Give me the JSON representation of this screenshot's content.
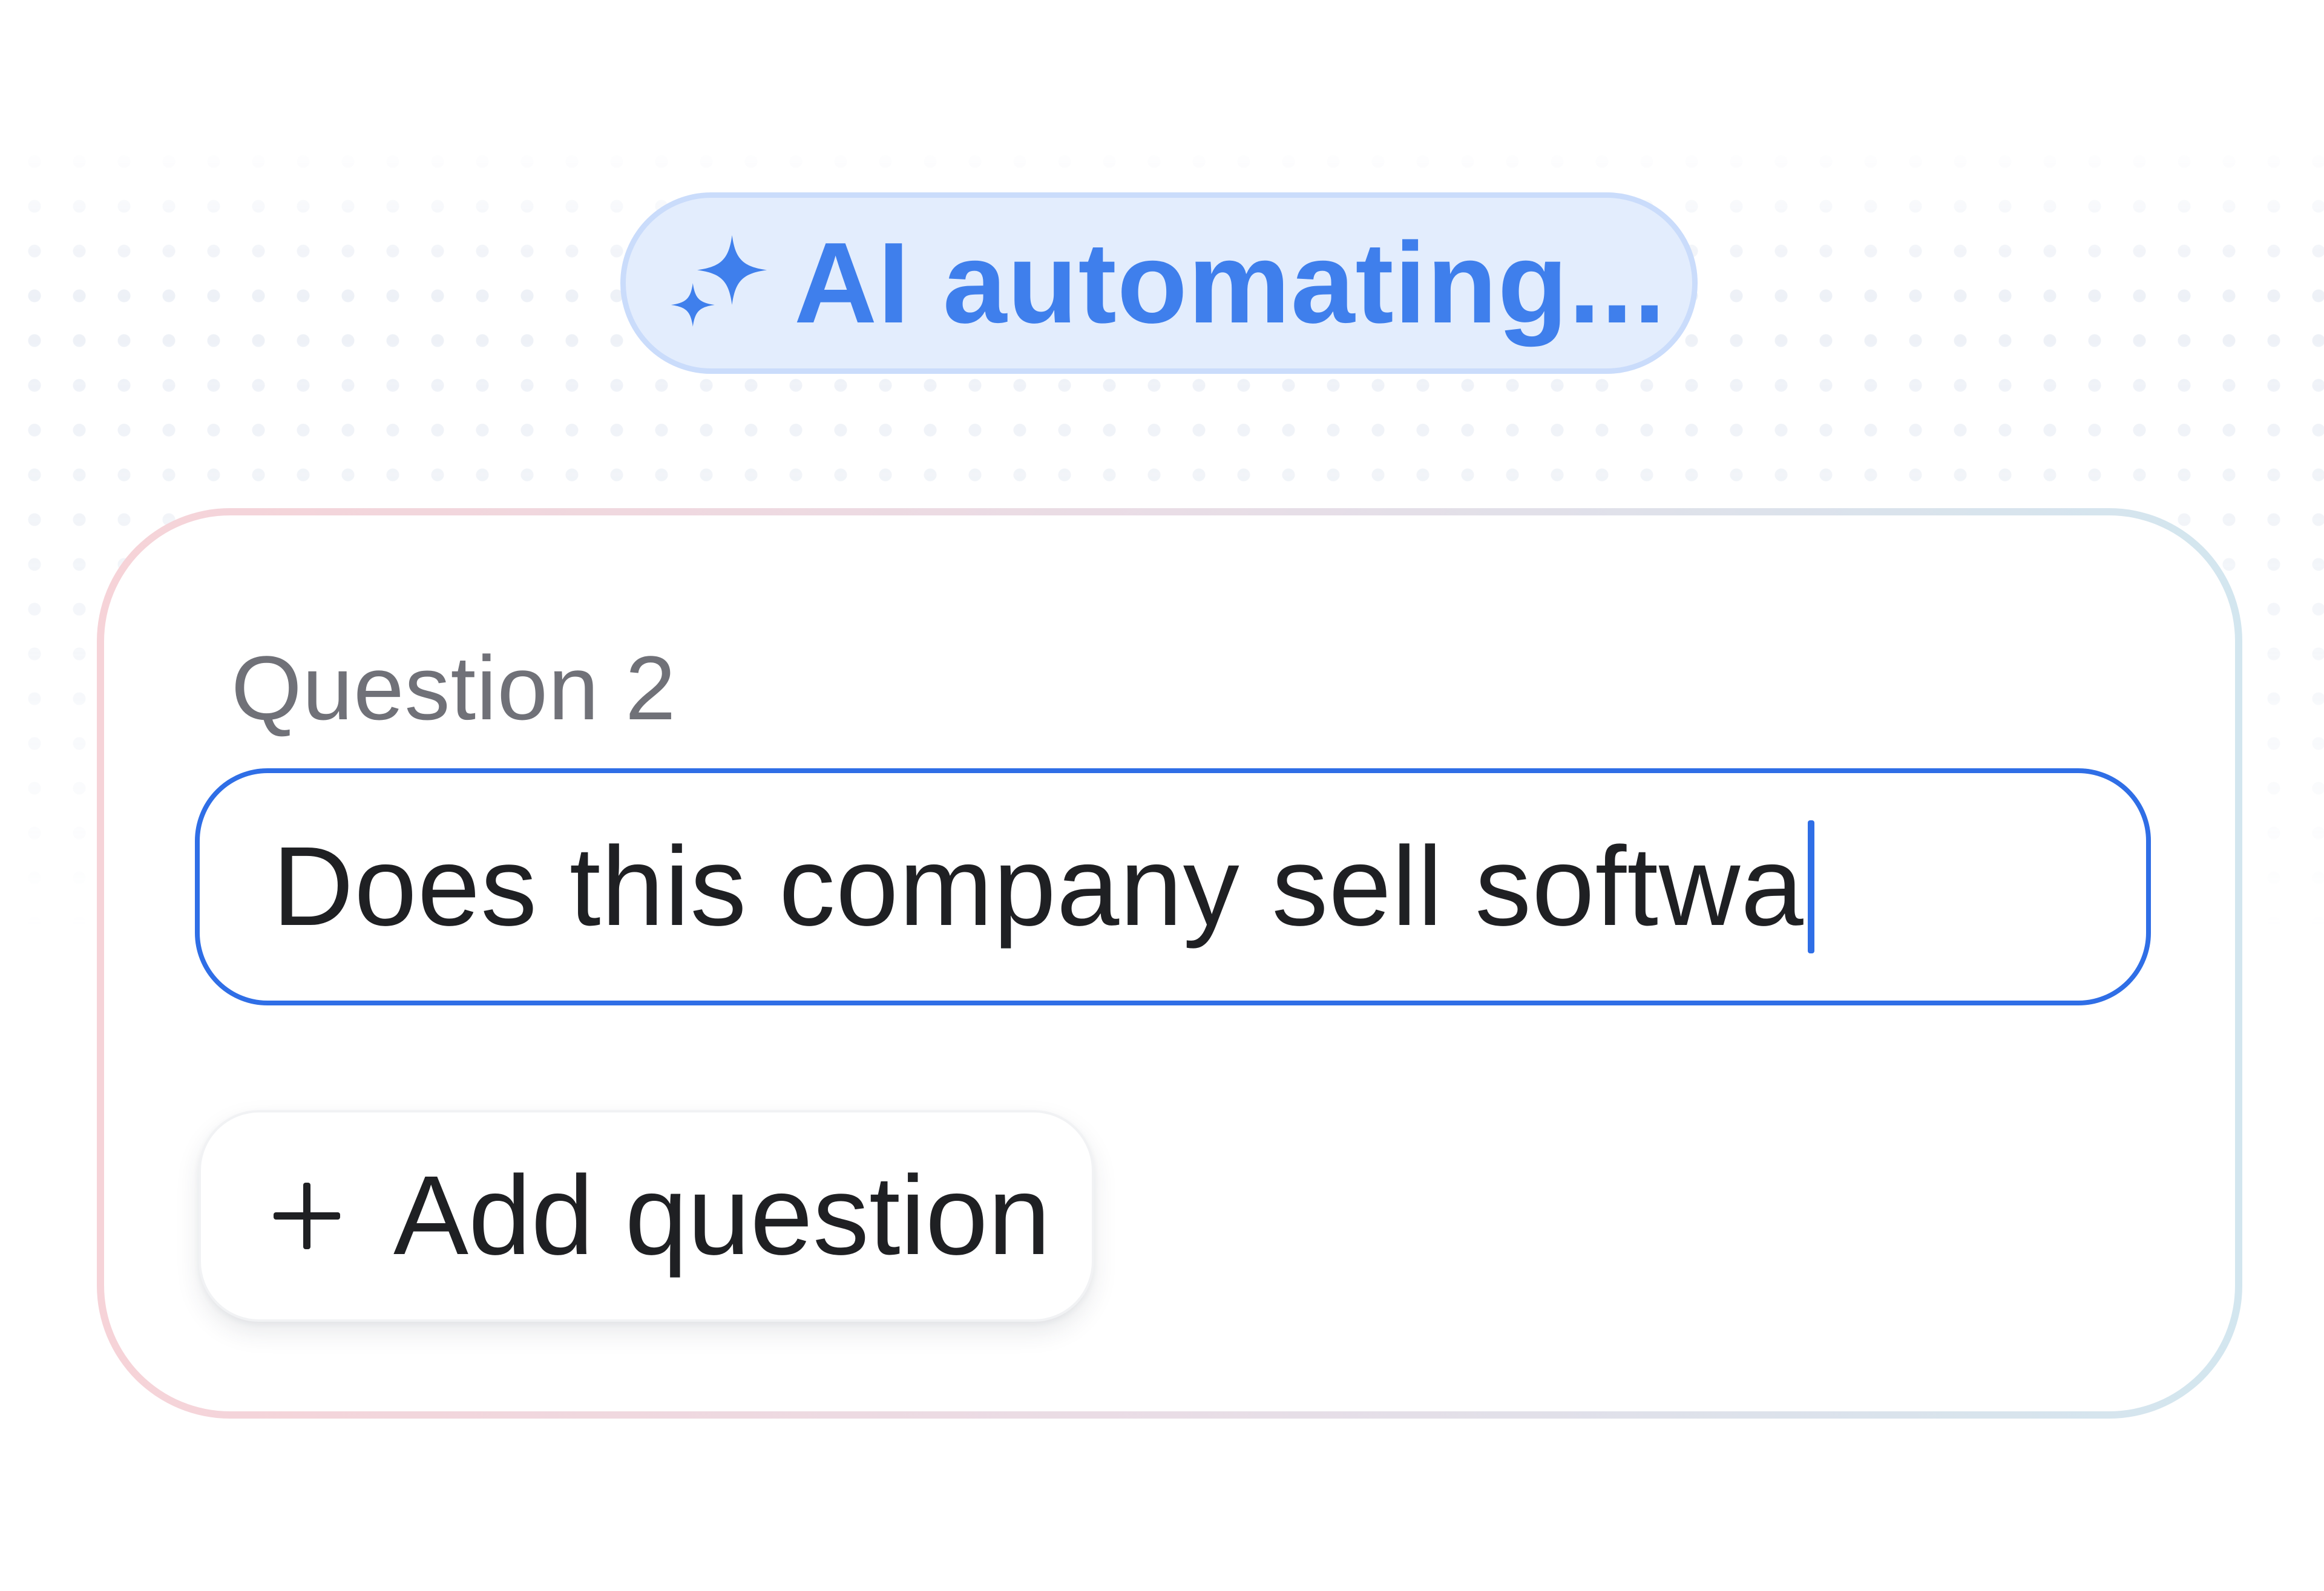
{
  "status_pill": {
    "icon": "sparkle-icon",
    "label": "AI automating..."
  },
  "question_card": {
    "label": "Question 2",
    "input_value": "Does this company sell softwa",
    "add_button_icon": "plus-icon",
    "add_button_label": "Add question"
  },
  "colors": {
    "accent": "#2f6ee6",
    "ai_text": "#3f7fec",
    "ai_pill_bg": "#e3edfd",
    "label_gray": "#707178",
    "text_dark": "#1f2023"
  }
}
